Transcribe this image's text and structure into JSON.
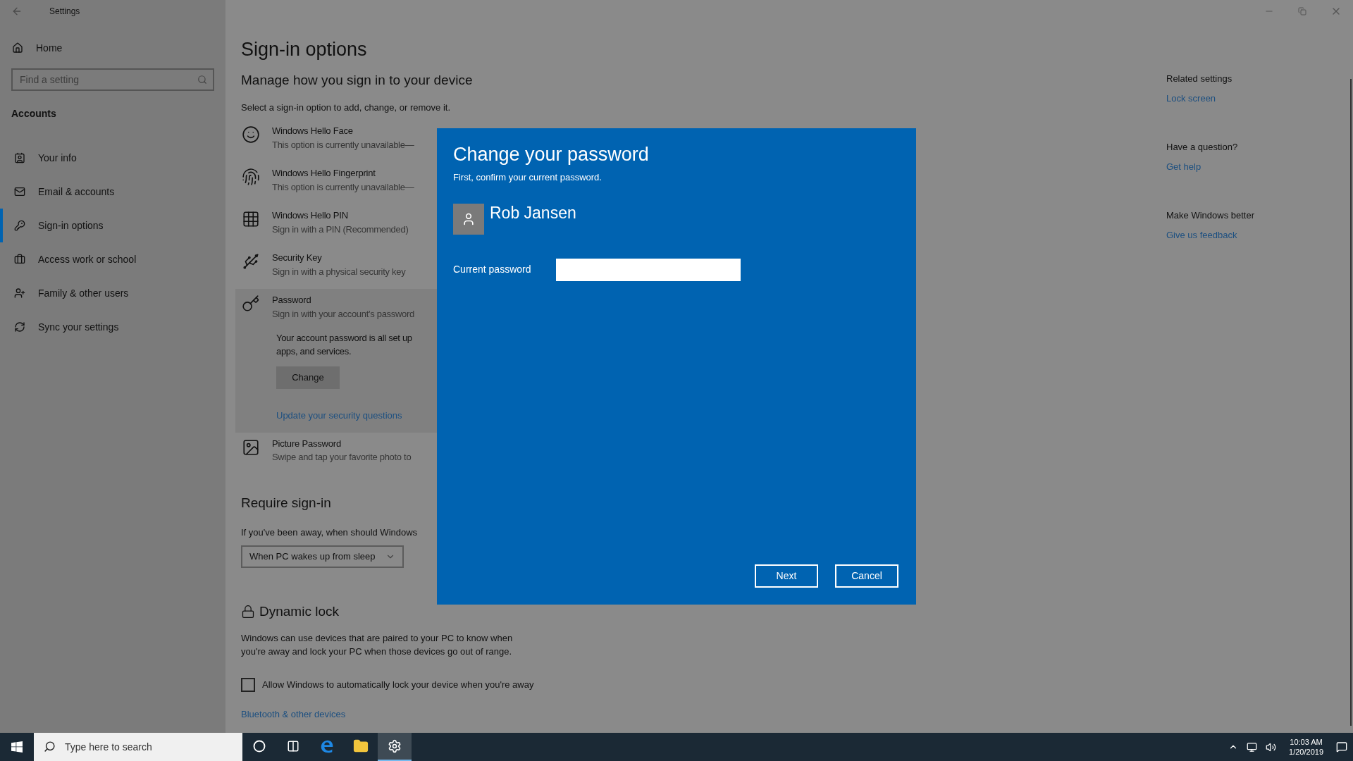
{
  "window": {
    "title": "Settings"
  },
  "sidebar": {
    "home": "Home",
    "search": {
      "placeholder": "Find a setting"
    },
    "section": "Accounts",
    "items": [
      {
        "kind": "info",
        "label": "Your info",
        "selected": false
      },
      {
        "kind": "email",
        "label": "Email & accounts",
        "selected": false
      },
      {
        "kind": "signin",
        "label": "Sign-in options",
        "selected": true
      },
      {
        "kind": "work",
        "label": "Access work or school",
        "selected": false
      },
      {
        "kind": "family",
        "label": "Family & other users",
        "selected": false
      },
      {
        "kind": "sync",
        "label": "Sync your settings",
        "selected": false
      }
    ]
  },
  "page": {
    "title": "Sign-in options",
    "subtitle": "Manage how you sign in to your device",
    "intro": "Select a sign-in option to add, change, or remove it.",
    "options": [
      {
        "kind": "face",
        "title": "Windows Hello Face",
        "description": "This option is currently unavailable—",
        "expanded": false
      },
      {
        "kind": "fingerprint",
        "title": "Windows Hello Fingerprint",
        "description": "This option is currently unavailable—",
        "expanded": false
      },
      {
        "kind": "pin",
        "title": "Windows Hello PIN",
        "description": "Sign in with a PIN (Recommended)",
        "expanded": false
      },
      {
        "kind": "security-key",
        "title": "Security Key",
        "description": "Sign in with a physical security key",
        "expanded": false
      },
      {
        "kind": "password",
        "title": "Password",
        "description": "Sign in with your account's password",
        "expanded": true,
        "detail_lines": [
          "Your account password is all set up",
          "apps, and services."
        ],
        "button": "Change",
        "link": "Update your security questions"
      },
      {
        "kind": "picture",
        "title": "Picture Password",
        "description": "Swipe and tap your favorite photo to",
        "expanded": false
      }
    ],
    "require_signin": {
      "heading": "Require sign-in",
      "question": "If you've been away, when should Windows",
      "dropdown": {
        "value": "When PC wakes up from sleep"
      }
    },
    "dynamic_lock": {
      "heading": "Dynamic lock",
      "description_lines": [
        "Windows can use devices that are paired to your PC to know when",
        "you're away and lock your PC when those devices go out of range."
      ],
      "checkbox": {
        "label": "Allow Windows to automatically lock your device when you're away",
        "checked": false
      }
    },
    "bottom_link": "Bluetooth & other devices"
  },
  "related": [
    {
      "heading": "Related settings",
      "link": "Lock screen"
    },
    {
      "heading": "Have a question?",
      "link": "Get help"
    },
    {
      "heading": "Make Windows better",
      "link": "Give us feedback"
    }
  ],
  "dialog": {
    "title": "Change your password",
    "subtitle": "First, confirm your current password.",
    "user": "Rob Jansen",
    "field_label": "Current password",
    "buttons": [
      "Next",
      "Cancel"
    ]
  },
  "taskbar": {
    "search": {
      "placeholder": "Type here to search"
    },
    "apps": [
      {
        "kind": "cortana",
        "selected": false
      },
      {
        "kind": "task-view",
        "selected": false
      },
      {
        "kind": "edge",
        "selected": false
      },
      {
        "kind": "explorer",
        "selected": false
      },
      {
        "kind": "settings",
        "selected": true
      }
    ],
    "clock": {
      "time": "10:03 AM",
      "date": "1/20/2019"
    }
  }
}
